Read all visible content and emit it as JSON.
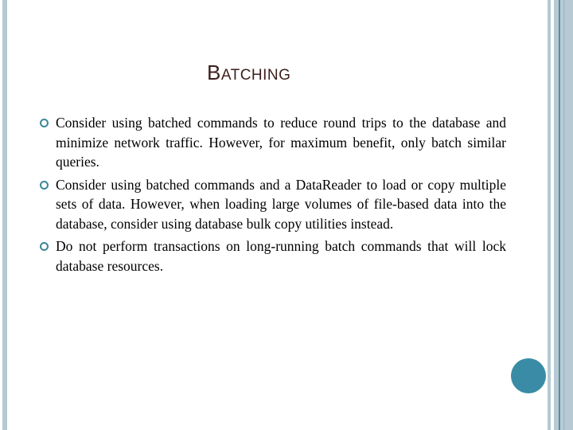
{
  "slide": {
    "title_first_letter": "B",
    "title_rest": "ATCHING",
    "bullets": [
      {
        "icon": "hollow-circle-bullet-icon",
        "text": "Consider using batched commands to reduce round trips to the database and minimize network traffic. However, for maximum benefit, only batch similar queries."
      },
      {
        "icon": "hollow-circle-bullet-icon",
        "text": "Consider using batched commands and a DataReader to load or copy multiple sets of data. However, when loading large volumes of file-based data into the database, consider using database bulk copy utilities instead."
      },
      {
        "icon": "hollow-circle-bullet-icon",
        "text": "Do not perform transactions on long-running batch commands that will lock database resources."
      }
    ]
  },
  "colors": {
    "title": "#3d1f1c",
    "bullet_marker": "#3d8797",
    "accent_circle": "#3a8ca6",
    "side_stripes": "#b5cad3",
    "dark_stripe": "#5d8a9b"
  }
}
